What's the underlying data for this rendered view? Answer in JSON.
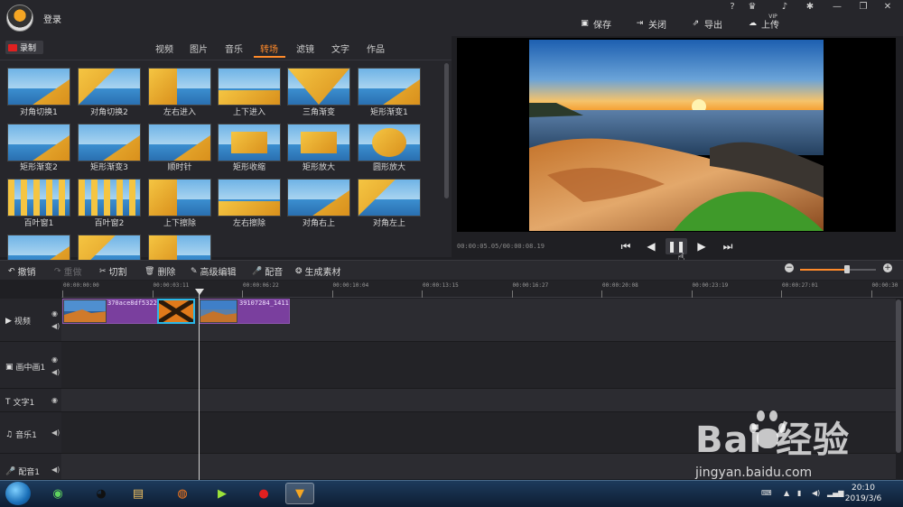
{
  "header": {
    "login_label": "登录",
    "help": "?",
    "vip": "VIP",
    "actions": [
      {
        "label": "保存",
        "icon": "save-icon"
      },
      {
        "label": "关闭",
        "icon": "close-project-icon"
      },
      {
        "label": "导出",
        "icon": "export-icon"
      },
      {
        "label": "上传",
        "icon": "upload-icon"
      }
    ]
  },
  "media": {
    "record_label": "录制",
    "tabs": [
      "视频",
      "图片",
      "音乐",
      "转场",
      "滤镜",
      "文字",
      "作品"
    ],
    "active_tab": "转场",
    "transitions": [
      "对角切换1",
      "对角切换2",
      "左右进入",
      "上下进入",
      "三角渐变",
      "矩形渐变1",
      "矩形渐变2",
      "矩形渐变3",
      "顺时针",
      "矩形收缩",
      "矩形放大",
      "圆形放大",
      "百叶窗1",
      "百叶窗2",
      "上下擦除",
      "左右擦除",
      "对角右上",
      "对角左上"
    ]
  },
  "player": {
    "time": "00:00:05.05/00:00:08.19"
  },
  "toolbar": {
    "undo": "撤销",
    "redo": "重做",
    "cut": "切割",
    "delete": "删除",
    "advanced_edit": "高级编辑",
    "dub": "配音",
    "generate": "生成素材"
  },
  "timeline": {
    "ticks": [
      "00:00:00:00",
      "00:00:03:11",
      "00:00:06:22",
      "00:00:10:04",
      "00:00:13:15",
      "00:00:16:27",
      "00:00:20:08",
      "00:00:23:19",
      "00:00:27:01",
      "00:00:30"
    ],
    "tracks": [
      "视频",
      "画中画1",
      "文字1",
      "音乐1",
      "配音1"
    ],
    "clip1_label": "370ace8df5322",
    "clip2_label": "39107284_1411"
  },
  "taskbar": {
    "time": "20:10",
    "date": "2019/3/6"
  },
  "watermark": {
    "brand": "Bai  经验",
    "url": "jingyan.baidu.com"
  },
  "colors": {
    "accent": "#ff8a2a",
    "clip": "#7a3f9e",
    "background": "#1f1f23"
  }
}
